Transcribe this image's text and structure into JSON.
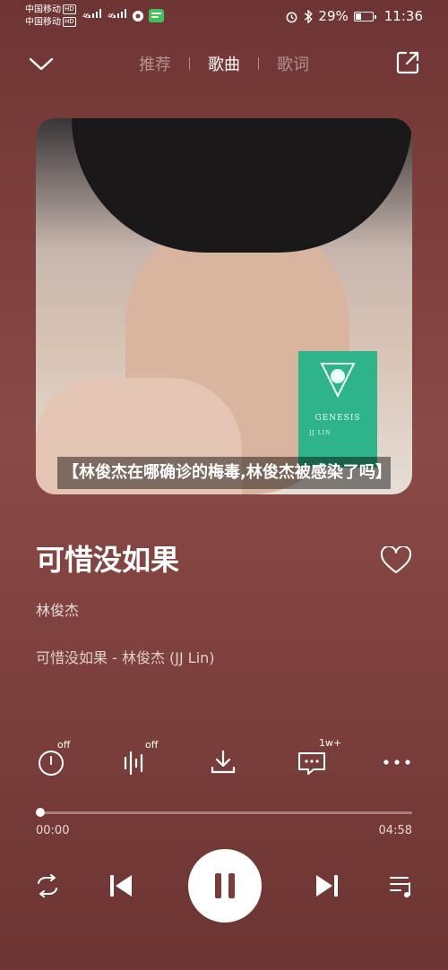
{
  "status_bar": {
    "carrier_1": "中国移动",
    "carrier_2": "中国移动",
    "hd": "HD",
    "signal_1": "46",
    "signal_2": "46",
    "battery": "29%",
    "time": "11:36"
  },
  "nav": {
    "tabs": [
      {
        "label": "推荐",
        "active": false
      },
      {
        "label": "歌曲",
        "active": true
      },
      {
        "label": "歌词",
        "active": false
      }
    ]
  },
  "album": {
    "cd_title": "GENESIS",
    "cd_artist": "JJ LIN"
  },
  "caption": "【林俊杰在哪确诊的梅毒,林俊杰被感染了吗】",
  "song": {
    "title": "可惜没如果",
    "artist": "林俊杰",
    "album_line": "可惜没如果 - 林俊杰 (JJ Lin)"
  },
  "actions": {
    "timer_badge": "off",
    "effect_badge": "off",
    "comments_badge": "1w+"
  },
  "player": {
    "elapsed": "00:00",
    "duration": "04:58",
    "progress_fraction": 0.0
  },
  "colors": {
    "background": "#7a3d3a",
    "accent": "#ffffff",
    "cd_green": "#2fb48a"
  }
}
